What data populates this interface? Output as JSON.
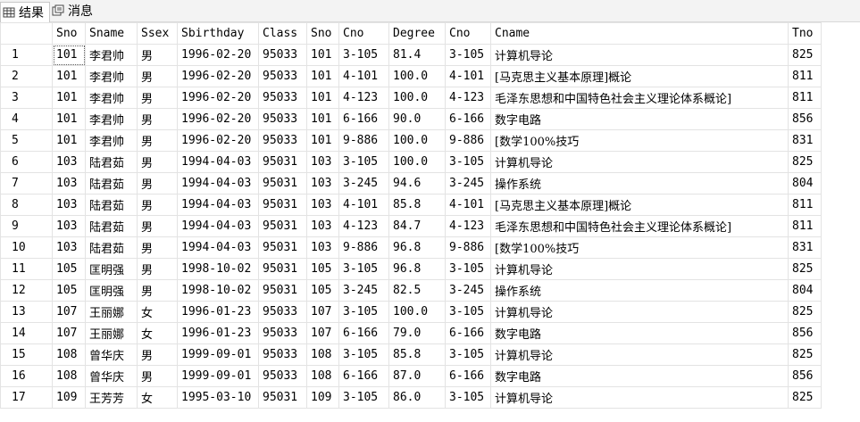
{
  "tabs": [
    {
      "label": "结果",
      "icon": "grid-icon",
      "active": true
    },
    {
      "label": "消息",
      "icon": "messages-icon",
      "active": false
    }
  ],
  "columns": [
    "",
    "Sno",
    "Sname",
    "Ssex",
    "Sbirthday",
    "Class",
    "Sno",
    "Cno",
    "Degree",
    "Cno",
    "Cname",
    "Tno"
  ],
  "rows": [
    [
      "1",
      "101",
      "李君帅",
      "男",
      "1996-02-20",
      "95033",
      "101",
      "3-105",
      "81.4",
      "3-105",
      "计算机导论",
      "825"
    ],
    [
      "2",
      "101",
      "李君帅",
      "男",
      "1996-02-20",
      "95033",
      "101",
      "4-101",
      "100.0",
      "4-101",
      "[马克思主义基本原理]概论",
      "811"
    ],
    [
      "3",
      "101",
      "李君帅",
      "男",
      "1996-02-20",
      "95033",
      "101",
      "4-123",
      "100.0",
      "4-123",
      "毛泽东思想和中国特色社会主义理论体系概论]",
      "811"
    ],
    [
      "4",
      "101",
      "李君帅",
      "男",
      "1996-02-20",
      "95033",
      "101",
      "6-166",
      "90.0",
      "6-166",
      "数字电路",
      "856"
    ],
    [
      "5",
      "101",
      "李君帅",
      "男",
      "1996-02-20",
      "95033",
      "101",
      "9-886",
      "100.0",
      "9-886",
      "[数学100%技巧",
      "831"
    ],
    [
      "6",
      "103",
      "陆君茹",
      "男",
      "1994-04-03",
      "95031",
      "103",
      "3-105",
      "100.0",
      "3-105",
      "计算机导论",
      "825"
    ],
    [
      "7",
      "103",
      "陆君茹",
      "男",
      "1994-04-03",
      "95031",
      "103",
      "3-245",
      "94.6",
      "3-245",
      "操作系统",
      "804"
    ],
    [
      "8",
      "103",
      "陆君茹",
      "男",
      "1994-04-03",
      "95031",
      "103",
      "4-101",
      "85.8",
      "4-101",
      "[马克思主义基本原理]概论",
      "811"
    ],
    [
      "9",
      "103",
      "陆君茹",
      "男",
      "1994-04-03",
      "95031",
      "103",
      "4-123",
      "84.7",
      "4-123",
      "毛泽东思想和中国特色社会主义理论体系概论]",
      "811"
    ],
    [
      "10",
      "103",
      "陆君茹",
      "男",
      "1994-04-03",
      "95031",
      "103",
      "9-886",
      "96.8",
      "9-886",
      "[数学100%技巧",
      "831"
    ],
    [
      "11",
      "105",
      "匡明强",
      "男",
      "1998-10-02",
      "95031",
      "105",
      "3-105",
      "96.8",
      "3-105",
      "计算机导论",
      "825"
    ],
    [
      "12",
      "105",
      "匡明强",
      "男",
      "1998-10-02",
      "95031",
      "105",
      "3-245",
      "82.5",
      "3-245",
      "操作系统",
      "804"
    ],
    [
      "13",
      "107",
      "王丽娜",
      "女",
      "1996-01-23",
      "95033",
      "107",
      "3-105",
      "100.0",
      "3-105",
      "计算机导论",
      "825"
    ],
    [
      "14",
      "107",
      "王丽娜",
      "女",
      "1996-01-23",
      "95033",
      "107",
      "6-166",
      "79.0",
      "6-166",
      "数字电路",
      "856"
    ],
    [
      "15",
      "108",
      "曾华庆",
      "男",
      "1999-09-01",
      "95033",
      "108",
      "3-105",
      "85.8",
      "3-105",
      "计算机导论",
      "825"
    ],
    [
      "16",
      "108",
      "曾华庆",
      "男",
      "1999-09-01",
      "95033",
      "108",
      "6-166",
      "87.0",
      "6-166",
      "数字电路",
      "856"
    ],
    [
      "17",
      "109",
      "王芳芳",
      "女",
      "1995-03-10",
      "95031",
      "109",
      "3-105",
      "86.0",
      "3-105",
      "计算机导论",
      "825"
    ]
  ]
}
